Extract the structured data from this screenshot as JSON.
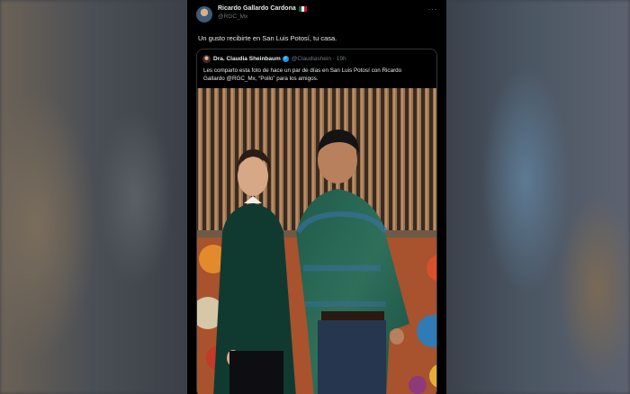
{
  "tweet": {
    "author_name": "Ricardo Gallardo Cardona",
    "author_handle": "@RGC_Mx",
    "more_glyph": "···",
    "text": "Un gusto recibirte en San Luis Potosí, tu casa."
  },
  "quote": {
    "author_name": "Dra. Claudia Sheinbaum",
    "author_handle": "@Claudiashein · 19h",
    "verified_glyph": "✓",
    "text_line1": "Les comparto esta foto de hace un par de días en San Luis Potosí con Ricardo",
    "text_line2": "Gallardo @RGC_Mx, “Pollo” para los amigos."
  },
  "colors": {
    "background": "#000000",
    "text": "#e7e9ea",
    "muted": "#71767b",
    "border": "#2f3336",
    "verified": "#1d9bf0"
  }
}
